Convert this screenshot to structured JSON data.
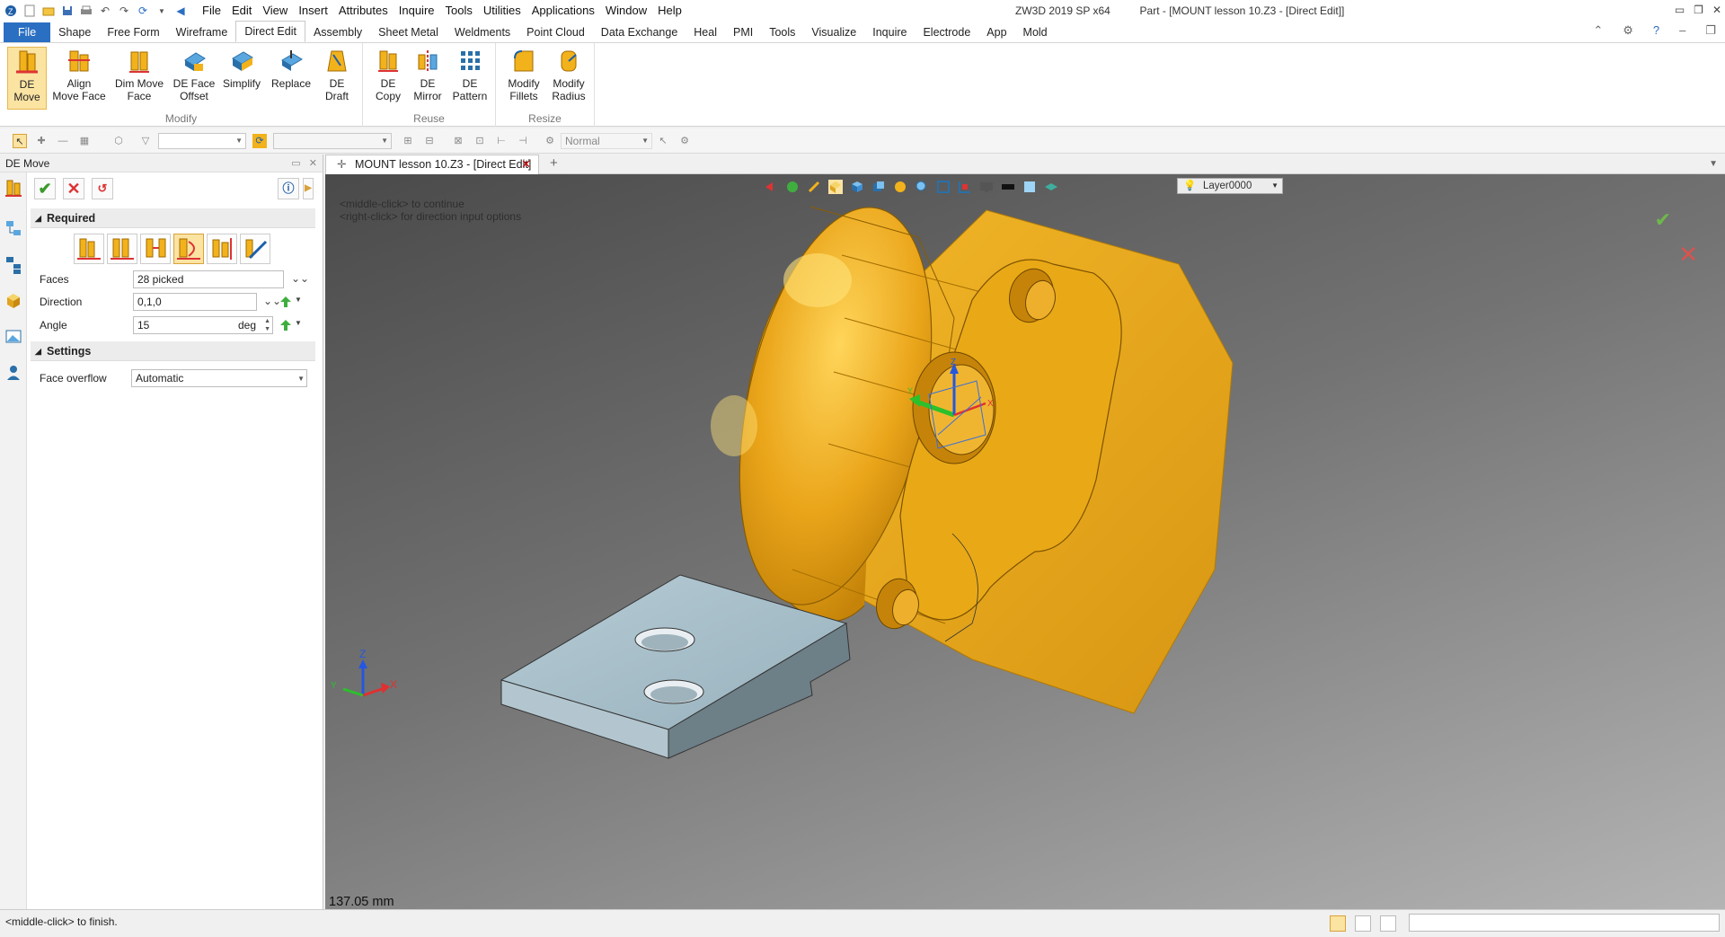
{
  "window": {
    "title": "ZW3D 2019 SP x64",
    "doc_title": "Part - [MOUNT lesson 10.Z3 - [Direct Edit]]",
    "controls": [
      "⌃",
      "⚙",
      "?",
      "–",
      "❐",
      "✕"
    ]
  },
  "menu": [
    "File",
    "Edit",
    "View",
    "Insert",
    "Attributes",
    "Inquire",
    "Tools",
    "Utilities",
    "Applications",
    "Window",
    "Help"
  ],
  "ribbon_tabs": [
    "File",
    "Shape",
    "Free Form",
    "Wireframe",
    "Direct Edit",
    "Assembly",
    "Sheet Metal",
    "Weldments",
    "Point Cloud",
    "Data Exchange",
    "Heal",
    "PMI",
    "Tools",
    "Visualize",
    "Inquire",
    "Electrode",
    "App",
    "Mold"
  ],
  "ribbon": {
    "modify": {
      "label": "Modify",
      "de_move": "DE\nMove",
      "align_move_face": "Align\nMove Face",
      "dim_move_face": "Dim Move\nFace",
      "de_face_offset": "DE Face\nOffset",
      "simplify": "Simplify",
      "replace": "Replace",
      "de_draft": "DE\nDraft"
    },
    "reuse": {
      "label": "Reuse",
      "de_copy": "DE\nCopy",
      "de_mirror": "DE\nMirror",
      "de_pattern": "DE\nPattern"
    },
    "resize": {
      "label": "Resize",
      "modify_fillets": "Modify\nFillets",
      "modify_radius": "Modify\nRadius"
    }
  },
  "toolbar": {
    "render_mode": "Normal"
  },
  "panel": {
    "title": "DE Move",
    "required": {
      "label": "Required",
      "faces_label": "Faces",
      "faces_value": "28 picked",
      "direction_label": "Direction",
      "direction_value": "0,1,0",
      "angle_label": "Angle",
      "angle_value": "15",
      "angle_unit": "deg"
    },
    "settings": {
      "label": "Settings",
      "face_overflow_label": "Face overflow",
      "face_overflow_value": "Automatic"
    }
  },
  "doc_tab": {
    "label": "MOUNT lesson 10.Z3 - [Direct Edit]"
  },
  "viewport": {
    "hint1": "<middle-click> to continue",
    "hint2": "<right-click> for direction input options",
    "layer": "Layer0000",
    "measure": "137.05 mm",
    "triad_x": "X",
    "triad_y": "Y",
    "triad_z": "Z"
  },
  "status": {
    "text": "<middle-click> to finish."
  },
  "colors": {
    "accent": "#2b6fc2",
    "model_gold": "#f2b21c",
    "plate": "#a9bfca",
    "ok_green": "#6eb84b",
    "cancel_red": "#d9534f"
  }
}
